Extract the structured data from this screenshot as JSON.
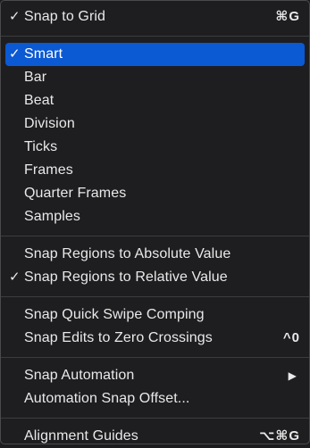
{
  "menu": {
    "snap_to_grid": {
      "check": "✓",
      "label": "Snap to Grid",
      "shortcut": "⌘G"
    },
    "grid_modes": [
      {
        "check": "✓",
        "label": "Smart",
        "selected": true
      },
      {
        "check": "",
        "label": "Bar"
      },
      {
        "check": "",
        "label": "Beat"
      },
      {
        "check": "",
        "label": "Division"
      },
      {
        "check": "",
        "label": "Ticks"
      },
      {
        "check": "",
        "label": "Frames"
      },
      {
        "check": "",
        "label": "Quarter Frames"
      },
      {
        "check": "",
        "label": "Samples"
      }
    ],
    "snap_regions_absolute": {
      "check": "",
      "label": "Snap Regions to Absolute Value"
    },
    "snap_regions_relative": {
      "check": "✓",
      "label": "Snap Regions to Relative Value"
    },
    "quick_swipe": {
      "label": "Snap Quick Swipe Comping"
    },
    "zero_crossings": {
      "label": "Snap Edits to Zero Crossings",
      "shortcut": "^0"
    },
    "snap_automation": {
      "label": "Snap Automation",
      "submenu_arrow": "▶"
    },
    "automation_offset": {
      "label": "Automation Snap Offset..."
    },
    "alignment_guides": {
      "label": "Alignment Guides",
      "shortcut": "⌥⌘G"
    }
  }
}
